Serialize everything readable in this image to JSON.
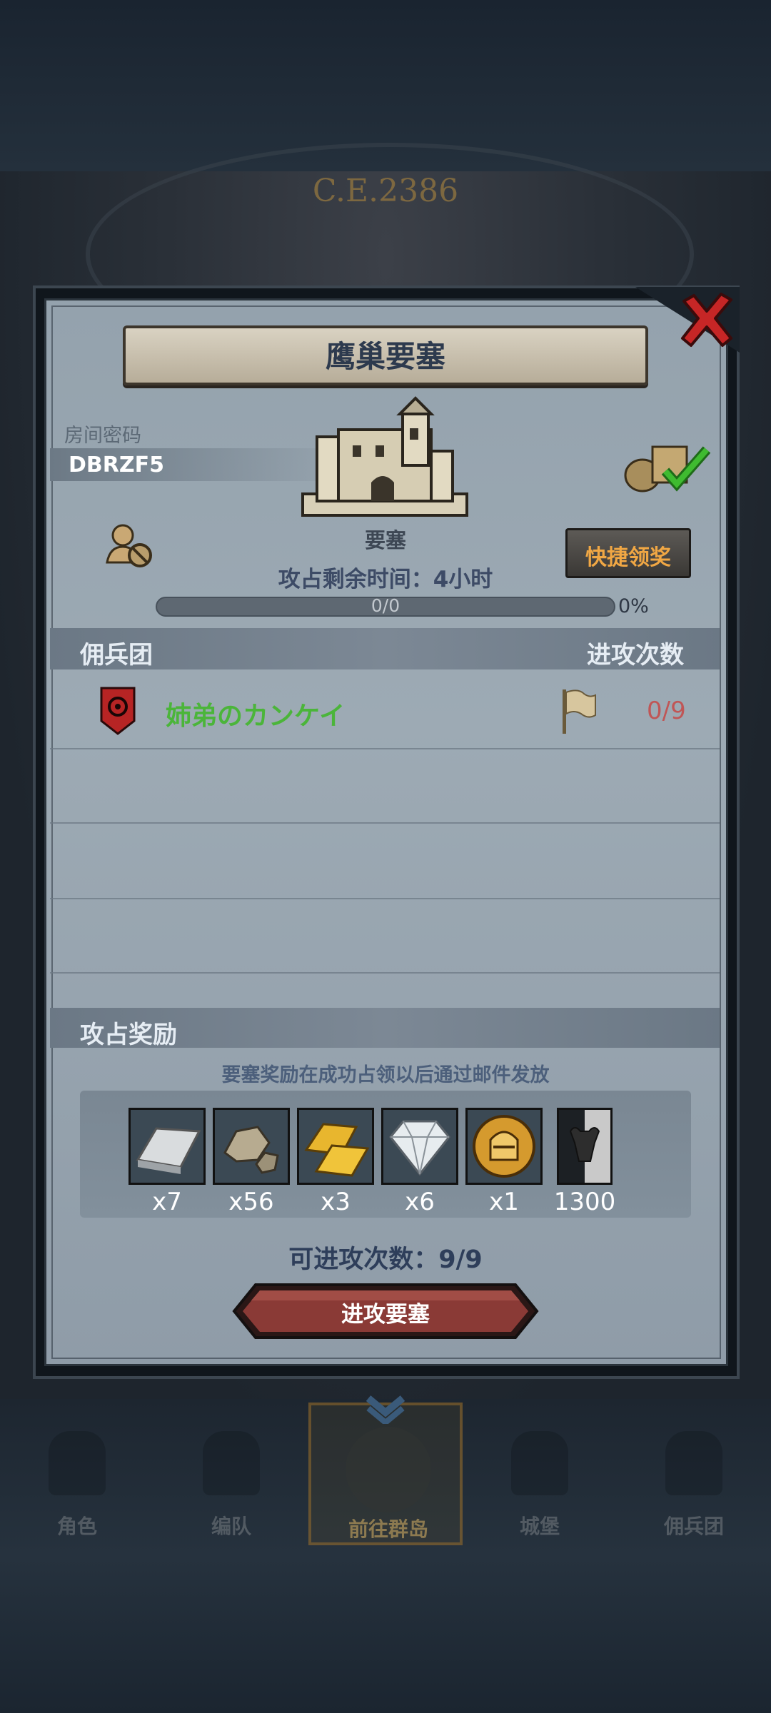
{
  "background": {
    "era": "C.E.2386"
  },
  "panel": {
    "title": "鹰巢要塞",
    "room_label": "房间密码",
    "room_code": "DBRZF5",
    "fortress_label": "要塞",
    "quick_claim_label": "快捷领奖",
    "time_remaining": "攻占剩余时间：4小时",
    "progress": {
      "text": "0/0",
      "percent_text": "0%",
      "fraction": 0
    },
    "mercenary_header": "佣兵团",
    "attacks_header": "进攻次数",
    "mercenary_rows": [
      {
        "name": "姉弟のカンケイ",
        "attacks": "0/9"
      }
    ],
    "reward_header": "攻占奖励",
    "reward_note": "要塞奖励在成功占领以后通过邮件发放",
    "rewards": [
      {
        "icon": "silver-ingot-icon",
        "qty": "x7"
      },
      {
        "icon": "ore-icon",
        "qty": "x56"
      },
      {
        "icon": "gold-bars-icon",
        "qty": "x3"
      },
      {
        "icon": "diamond-icon",
        "qty": "x6"
      },
      {
        "icon": "knight-helmet-coin-icon",
        "qty": "x1"
      },
      {
        "icon": "bull-banner-icon",
        "qty": "1300"
      }
    ],
    "attack_count_text": "可进攻次数：9/9",
    "attack_button_label": "进攻要塞"
  },
  "bottom_nav": [
    {
      "label": "角色",
      "icon": "knight-icon"
    },
    {
      "label": "编队",
      "icon": "formation-icon"
    },
    {
      "label": "前往群岛",
      "icon": "islands-icon",
      "active": true
    },
    {
      "label": "城堡",
      "icon": "castle-icon"
    },
    {
      "label": "佣兵团",
      "icon": "mercenary-icon"
    }
  ],
  "colors": {
    "accent_gold": "#e2b862",
    "claim_orange": "#f0a744",
    "merc_name_green": "#4bb53a",
    "attack_count_red": "#c05656",
    "button_red": "#8a3a36"
  }
}
